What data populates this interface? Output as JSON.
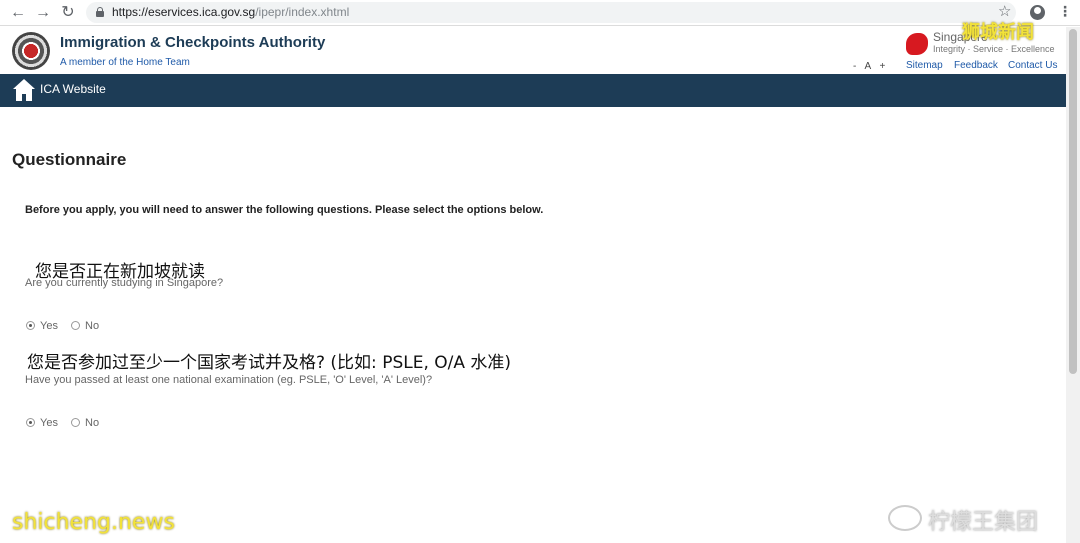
{
  "browser": {
    "url_main": "https://eservices.ica.gov.sg",
    "url_path": "/ipepr/index.xhtml",
    "back_icon": "←",
    "forward_icon": "→",
    "reload_icon": "↻",
    "star_icon": "☆",
    "menu_icon": "⋮"
  },
  "header": {
    "org_name": "Immigration & Checkpoints Authority",
    "org_sub": "A member of the Home Team",
    "sg_brand": "Singapore",
    "sg_tag": "Integrity · Service · Excellence",
    "font_controls": "- A +",
    "links": [
      "Sitemap",
      "Feedback",
      "Contact Us"
    ]
  },
  "nav": {
    "home_label": "ICA Website"
  },
  "content": {
    "title": "Questionnaire",
    "intro": "Before you apply, you will need to answer the following questions. Please select the options below.",
    "questions": [
      {
        "zh": "您是否正在新加坡就读",
        "en": "Are you currently studying in Singapore?",
        "options": [
          "Yes",
          "No"
        ],
        "selected": "Yes"
      },
      {
        "zh": "您是否参加过至少一个国家考试并及格? (比如: PSLE, O/A 水准)",
        "en": "Have you passed at least one national examination (eg. PSLE, 'O' Level, 'A' Level)?",
        "options": [
          "Yes",
          "No"
        ],
        "selected": "Yes"
      }
    ]
  },
  "watermarks": {
    "top_right": "狮城新闻",
    "bottom_left": "shicheng.news",
    "bottom_right": "柠檬王集团"
  },
  "colors": {
    "brand_navy": "#1d3c56",
    "link_blue": "#1f5aa8",
    "watermark_yellow": "#f2e23a"
  }
}
